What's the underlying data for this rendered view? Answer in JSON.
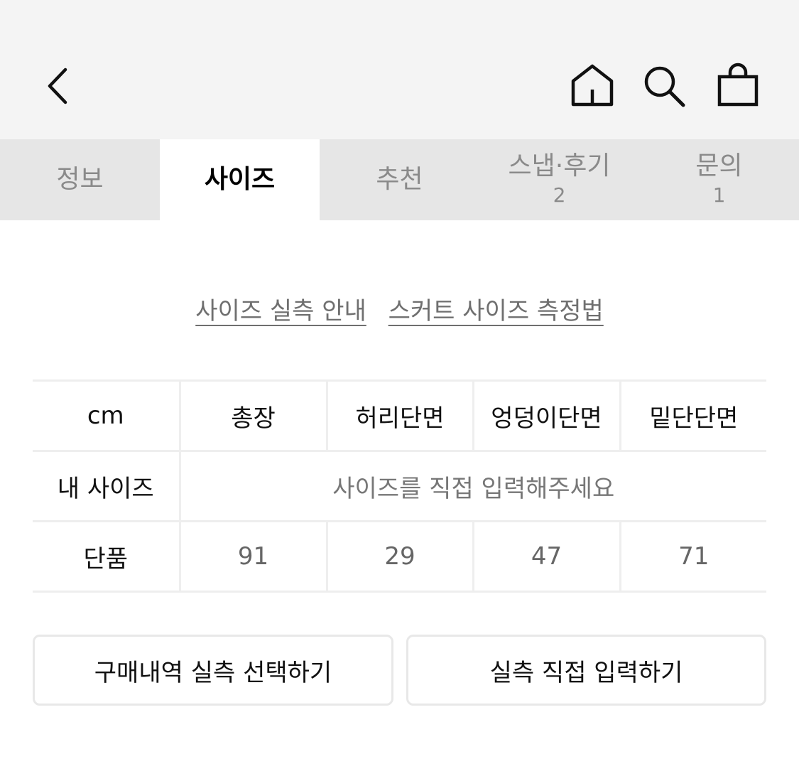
{
  "header": {
    "icons": [
      "back-icon",
      "home-icon",
      "search-icon",
      "shopping-bag-icon"
    ]
  },
  "tabs": [
    {
      "label": "정보",
      "count": "",
      "active": false
    },
    {
      "label": "사이즈",
      "count": "",
      "active": true
    },
    {
      "label": "추천",
      "count": "",
      "active": false
    },
    {
      "label": "스냅·후기",
      "count": "2",
      "active": false
    },
    {
      "label": "문의",
      "count": "1",
      "active": false
    }
  ],
  "guide_links": {
    "size_guide": "사이즈 실측 안내",
    "measure_guide": "스커트 사이즈 측정법"
  },
  "size_table": {
    "unit": "cm",
    "columns": [
      "총장",
      "허리단면",
      "엉덩이단면",
      "밑단단면"
    ],
    "my_size": {
      "label": "내 사이즈",
      "placeholder": "사이즈를 직접 입력해주세요"
    },
    "product": {
      "label": "단품",
      "values": [
        "91",
        "29",
        "47",
        "71"
      ]
    }
  },
  "buttons": {
    "select_history": "구매내역 실측 선택하기",
    "manual_input": "실측 직접 입력하기"
  }
}
